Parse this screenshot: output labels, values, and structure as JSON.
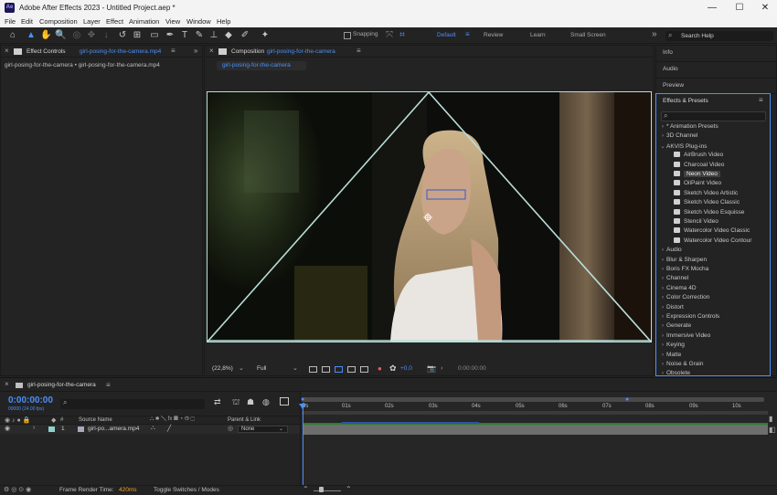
{
  "app": {
    "title": "Adobe After Effects 2023 - Untitled Project.aep *",
    "logo": "Ae"
  },
  "window_controls": {
    "minimize": "—",
    "maximize": "☐",
    "close": "✕"
  },
  "menu": [
    "File",
    "Edit",
    "Composition",
    "Layer",
    "Effect",
    "Animation",
    "View",
    "Window",
    "Help"
  ],
  "toolbar": {
    "snapping": "Snapping",
    "workspaces": [
      "Default",
      "Review",
      "Learn",
      "Small Screen"
    ],
    "overflow": "»",
    "search_placeholder": "Search Help"
  },
  "effect_controls": {
    "title": "Effect Controls",
    "clip": "girl-posing-for-the-camera.mp4",
    "breadcrumb": "girl-posing-for-the-camera • girl-posing-for-the-camera.mp4"
  },
  "composition": {
    "title": "Composition",
    "name": "girl-posing-for-the-camera",
    "tab": "girl-posing-for-the-camera",
    "zoom": "(22,8%)",
    "resolution": "Full",
    "exposure": "+0,0",
    "timecode": "0:00:00:00"
  },
  "right_panels": {
    "info": "Info",
    "audio": "Audio",
    "preview": "Preview"
  },
  "effects_presets": {
    "title": "Effects & Presets",
    "search": "",
    "items": [
      {
        "label": "* Animation Presets",
        "type": "folder"
      },
      {
        "label": "3D Channel",
        "type": "folder"
      },
      {
        "label": "AKVIS Plug-ins",
        "type": "folder-open"
      },
      {
        "label": "AirBrush Video",
        "type": "effect"
      },
      {
        "label": "Charcoal Video",
        "type": "effect"
      },
      {
        "label": "Neon Video",
        "type": "effect",
        "selected": true
      },
      {
        "label": "OilPaint Video",
        "type": "effect"
      },
      {
        "label": "Sketch Video Artistic",
        "type": "effect"
      },
      {
        "label": "Sketch Video Classic",
        "type": "effect"
      },
      {
        "label": "Sketch Video Esquisse",
        "type": "effect"
      },
      {
        "label": "Stencil Video",
        "type": "effect"
      },
      {
        "label": "Watercolor Video Classic",
        "type": "effect"
      },
      {
        "label": "Watercolor Video Contour",
        "type": "effect"
      },
      {
        "label": "Audio",
        "type": "folder"
      },
      {
        "label": "Blur & Sharpen",
        "type": "folder"
      },
      {
        "label": "Boris FX Mocha",
        "type": "folder"
      },
      {
        "label": "Channel",
        "type": "folder"
      },
      {
        "label": "Cinema 4D",
        "type": "folder"
      },
      {
        "label": "Color Correction",
        "type": "folder"
      },
      {
        "label": "Distort",
        "type": "folder"
      },
      {
        "label": "Expression Controls",
        "type": "folder"
      },
      {
        "label": "Generate",
        "type": "folder"
      },
      {
        "label": "Immersive Video",
        "type": "folder"
      },
      {
        "label": "Keying",
        "type": "folder"
      },
      {
        "label": "Matte",
        "type": "folder"
      },
      {
        "label": "Noise & Grain",
        "type": "folder"
      },
      {
        "label": "Obsolete",
        "type": "folder"
      }
    ]
  },
  "timeline": {
    "tab": "girl-posing-for-the-camera",
    "timecode": "0:00:00:00",
    "fps": "00000 (24.00 fps)",
    "search": "",
    "columns": {
      "hash": "#",
      "source": "Source Name",
      "parent": "Parent & Link"
    },
    "ruler": [
      "0s",
      "01s",
      "02s",
      "03s",
      "04s",
      "05s",
      "06s",
      "07s",
      "08s",
      "09s",
      "10s"
    ],
    "layer": {
      "num": "1",
      "name": "girl-po...amera.mp4",
      "parent": "None"
    }
  },
  "status": {
    "render_label": "Frame Render Time:",
    "render_value": "420ms",
    "toggle": "Toggle Switches / Modes"
  },
  "colors": {
    "accent": "#4d8ff7",
    "panel": "#232323",
    "outline": "#b9ddd8",
    "layer_bar": "#2e7d32"
  }
}
